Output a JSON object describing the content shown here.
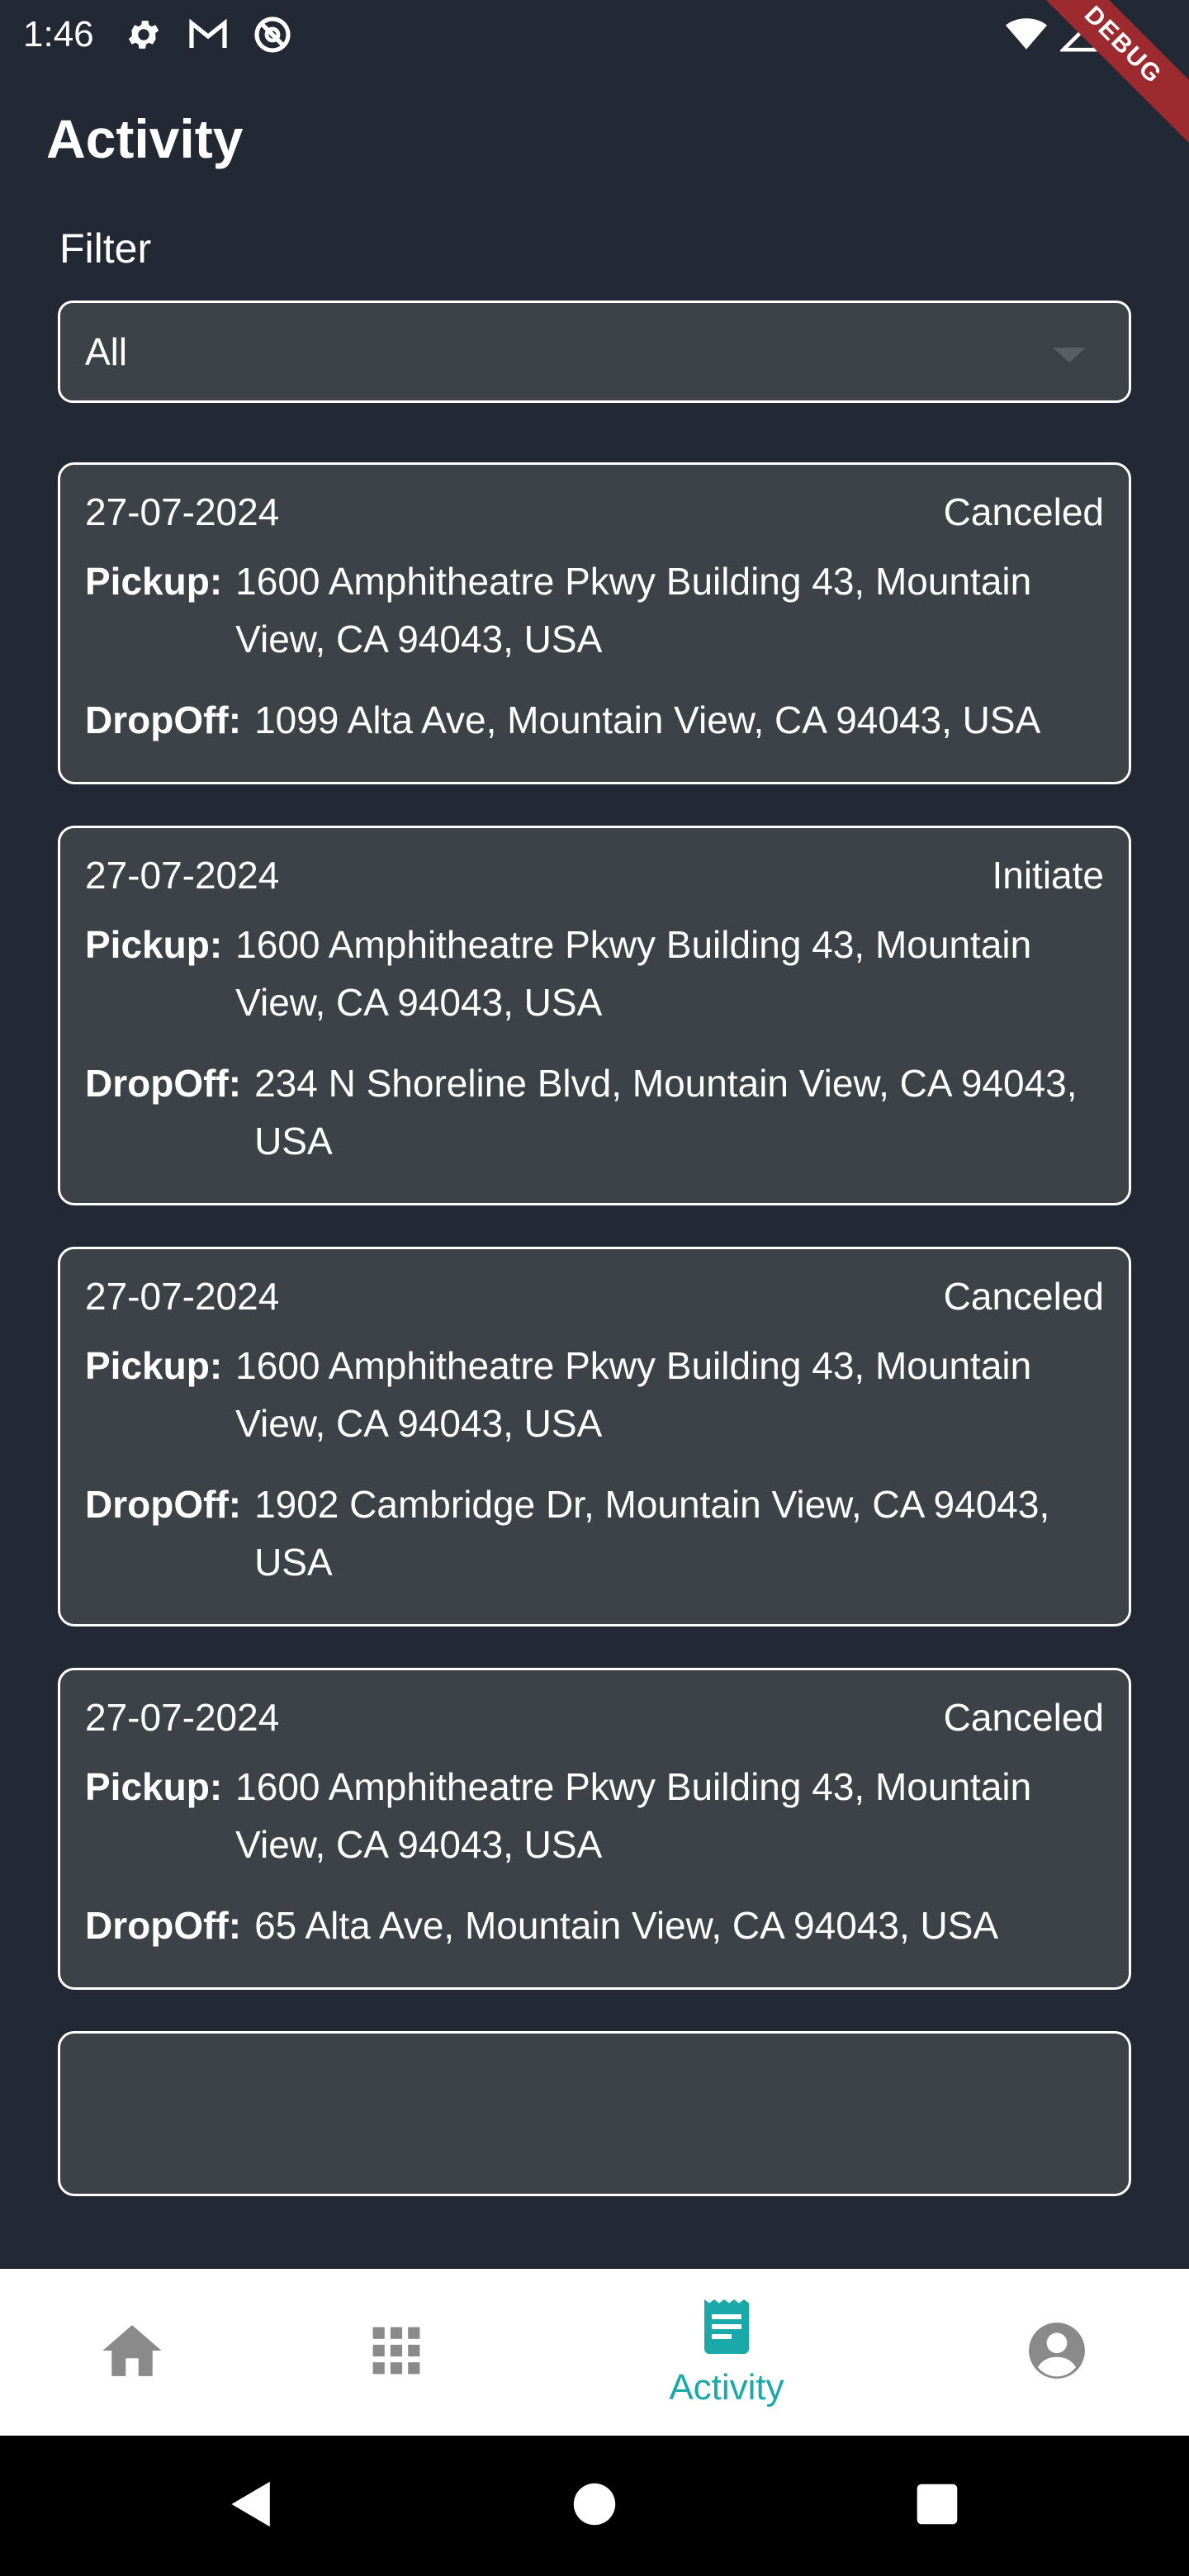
{
  "status_bar": {
    "time": "1:46",
    "icons": [
      "gear-icon",
      "gmail-icon",
      "no-entry-icon"
    ],
    "right_icons": [
      "wifi-icon",
      "signal-icon"
    ],
    "debug_banner": "DEBUG"
  },
  "page": {
    "title": "Activity",
    "filter_label": "Filter",
    "filter_value": "All"
  },
  "rides": [
    {
      "date": "27-07-2024",
      "status": "Canceled",
      "pickup_label": "Pickup:",
      "pickup": "1600 Amphitheatre Pkwy Building 43, Mountain View, CA 94043, USA",
      "dropoff_label": "DropOff:",
      "dropoff": "1099 Alta Ave, Mountain View, CA 94043, USA"
    },
    {
      "date": "27-07-2024",
      "status": "Initiate",
      "pickup_label": "Pickup:",
      "pickup": "1600 Amphitheatre Pkwy Building 43, Mountain View, CA 94043, USA",
      "dropoff_label": "DropOff:",
      "dropoff": "234 N Shoreline Blvd, Mountain View, CA 94043, USA"
    },
    {
      "date": "27-07-2024",
      "status": "Canceled",
      "pickup_label": "Pickup:",
      "pickup": "1600 Amphitheatre Pkwy Building 43, Mountain View, CA 94043, USA",
      "dropoff_label": "DropOff:",
      "dropoff": "1902 Cambridge Dr, Mountain View, CA 94043, USA"
    },
    {
      "date": "27-07-2024",
      "status": "Canceled",
      "pickup_label": "Pickup:",
      "pickup": "1600 Amphitheatre Pkwy Building 43, Mountain View, CA 94043, USA",
      "dropoff_label": "DropOff:",
      "dropoff": "65 Alta Ave, Mountain View, CA 94043, USA"
    },
    {
      "date": "",
      "status": "",
      "pickup_label": "",
      "pickup": "",
      "dropoff_label": "",
      "dropoff": ""
    }
  ],
  "bottom_nav": {
    "items": [
      {
        "icon": "home-icon",
        "label": ""
      },
      {
        "icon": "apps-grid-icon",
        "label": ""
      },
      {
        "icon": "receipt-icon",
        "label": "Activity"
      },
      {
        "icon": "account-icon",
        "label": ""
      }
    ],
    "active_color": "#1aa8a8",
    "inactive_color": "#8a8a8a"
  },
  "system_nav": {
    "icons": [
      "back-icon",
      "home-circle-icon",
      "recents-icon"
    ]
  }
}
